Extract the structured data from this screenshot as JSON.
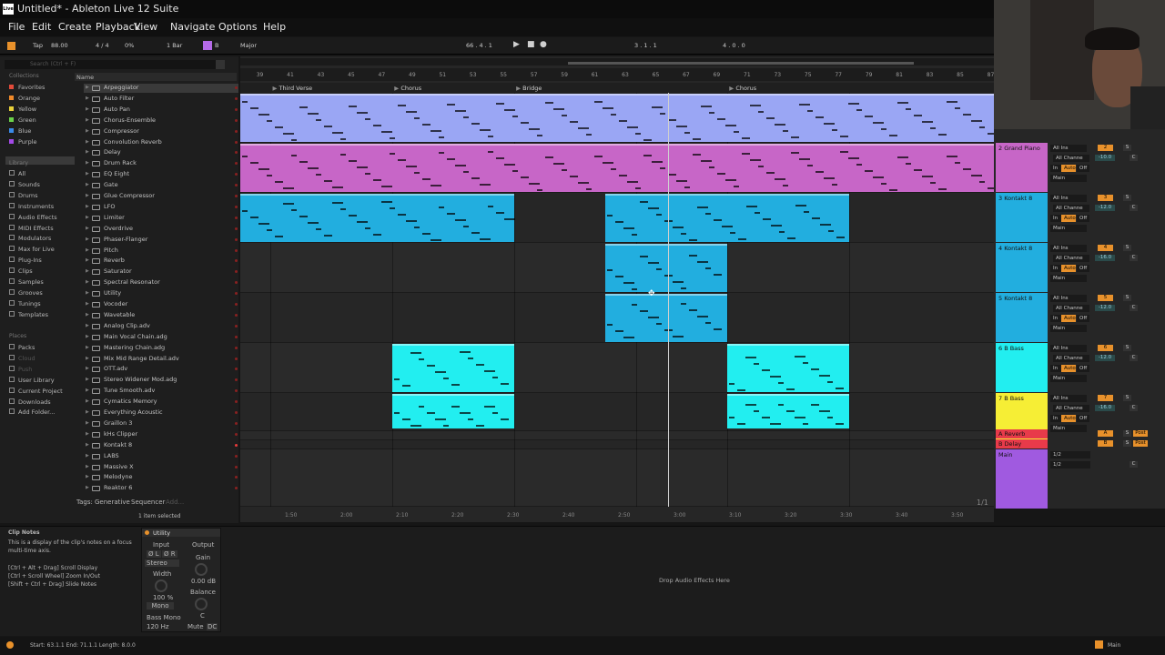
{
  "app": {
    "title": "Untitled* - Ableton Live 12 Suite",
    "logo": "Live"
  },
  "menu": [
    "File",
    "Edit",
    "Create",
    "Playback",
    "View",
    "Navigate",
    "Options",
    "Help"
  ],
  "transport": {
    "tap": "Tap",
    "tempo": "88.00",
    "sig": "4 / 4",
    "pct": "0%",
    "quant": "1 Bar",
    "key_root": "B",
    "scale": "Major",
    "pos": "66 .  4 .  1",
    "loop_start": "3 .  1 .  1",
    "loop_len": "4 .  0 .  0"
  },
  "browser": {
    "search_placeholder": "Search (Ctrl + F)",
    "collections_header": "Collections",
    "collections": [
      {
        "label": "Favorites",
        "color": "#e24b3a"
      },
      {
        "label": "Orange",
        "color": "#f08a2a"
      },
      {
        "label": "Yellow",
        "color": "#e8d13a"
      },
      {
        "label": "Green",
        "color": "#6bd14a"
      },
      {
        "label": "Blue",
        "color": "#3a8ae8"
      },
      {
        "label": "Purple",
        "color": "#a44ae8"
      }
    ],
    "library_header": "Library",
    "library": [
      "All",
      "Sounds",
      "Drums",
      "Instruments",
      "Audio Effects",
      "MIDI Effects",
      "Modulators",
      "Max for Live",
      "Plug-Ins",
      "Clips",
      "Samples",
      "Grooves",
      "Tunings",
      "Templates"
    ],
    "places_header": "Places",
    "places": [
      "Packs",
      "Cloud",
      "Push",
      "User Library",
      "Current Project",
      "Downloads",
      "Add Folder..."
    ],
    "name_header": "Name",
    "names": [
      "Arpeggiator",
      "Auto Filter",
      "Auto Pan",
      "Chorus-Ensemble",
      "Compressor",
      "Convolution Reverb",
      "Delay",
      "Drum Rack",
      "EQ Eight",
      "Gate",
      "Glue Compressor",
      "LFO",
      "Limiter",
      "Overdrive",
      "Phaser-Flanger",
      "Pitch",
      "Reverb",
      "Saturator",
      "Spectral Resonator",
      "Utility",
      "Vocoder",
      "Wavetable",
      "Analog Clip.adv",
      "Main Vocal Chain.adg",
      "Mastering Chain.adg",
      "Mix Mid Range Detail.adv",
      "OTT.adv",
      "Stereo Widener Mod.adg",
      "Tune Smooth.adv",
      "Cymatics Memory",
      "Everything Acoustic",
      "Graillon 3",
      "kHs Clipper",
      "Kontakt 8",
      "LABS",
      "Massive X",
      "Melodyne",
      "Reaktor 6"
    ],
    "tags_label": "Tags:",
    "tag1": "Generative",
    "tag2": "Sequencer",
    "tag3": "Add...",
    "selection": "1 item selected"
  },
  "ruler": {
    "bars": [
      "39",
      "41",
      "43",
      "45",
      "47",
      "49",
      "51",
      "53",
      "55",
      "57",
      "59",
      "61",
      "63",
      "65",
      "67",
      "69",
      "71",
      "73",
      "75",
      "77",
      "79",
      "81",
      "83",
      "85",
      "87"
    ],
    "times": [
      "1:50",
      "2:00",
      "2:10",
      "2:20",
      "2:30",
      "2:40",
      "2:50",
      "3:00",
      "3:10",
      "3:20",
      "3:30",
      "3:40",
      "3:50"
    ]
  },
  "locators": [
    "Third Verse",
    "Chorus",
    "Bridge",
    "Chorus"
  ],
  "zoom": "1/1",
  "tracks": [
    {
      "name": "2 Grand Piano",
      "color": "#c766c7",
      "num": "2",
      "vol": "-10.0"
    },
    {
      "name": "3 Kontakt 8",
      "color": "#22aedf",
      "num": "3",
      "vol": "-12.0"
    },
    {
      "name": "4 Kontakt 8",
      "color": "#22aedf",
      "num": "4",
      "vol": "-16.0"
    },
    {
      "name": "5 Kontakt 8",
      "color": "#22aedf",
      "num": "5",
      "vol": "-12.0"
    },
    {
      "name": "6 B Bass",
      "color": "#22eef0",
      "num": "6",
      "vol": "-12.0"
    },
    {
      "name": "7 B Bass",
      "color": "#f6ee35",
      "num": "7",
      "vol": "-16.0"
    }
  ],
  "returns": [
    {
      "name": "A Reverb",
      "color": "#e83a4a",
      "num": "A"
    },
    {
      "name": "B Delay",
      "color": "#e83a4a",
      "num": "B"
    }
  ],
  "main": {
    "name": "Main",
    "color": "#a05ae0"
  },
  "mixer_labels": {
    "input": "All Ins",
    "channel": "All Channe",
    "in": "In",
    "auto": "Auto",
    "off": "Off",
    "main": "Main",
    "post": "Post",
    "s": "S",
    "c": "C",
    "send": "1/2"
  },
  "info": {
    "title": "Clip Notes",
    "body1": "This is a display of the clip's notes on a focus",
    "body2": "multi-time axis.",
    "h1": "[Ctrl + Alt + Drag] Scroll Display",
    "h2": "[Ctrl + Scroll Wheel] Zoom In/Out",
    "h3": "[Shift + Ctrl + Drag] Slide Notes"
  },
  "device": {
    "title": "Utility",
    "input": "Input",
    "output": "Output",
    "phl": "Ø L",
    "phr": "Ø R",
    "stereo": "Stereo",
    "width": "Width",
    "width_val": "100 %",
    "mono": "Mono",
    "gain": "Gain",
    "gain_val": "0.00 dB",
    "balance": "Balance",
    "balance_val": "C",
    "bass_mono": "Bass Mono",
    "freq": "120 Hz",
    "mute": "Mute",
    "dc": "DC"
  },
  "drop_text": "Drop Audio Effects Here",
  "status": {
    "sel": "Start: 63.1.1  End: 71.1.1  Length: 8.0.0",
    "main": "Main"
  }
}
